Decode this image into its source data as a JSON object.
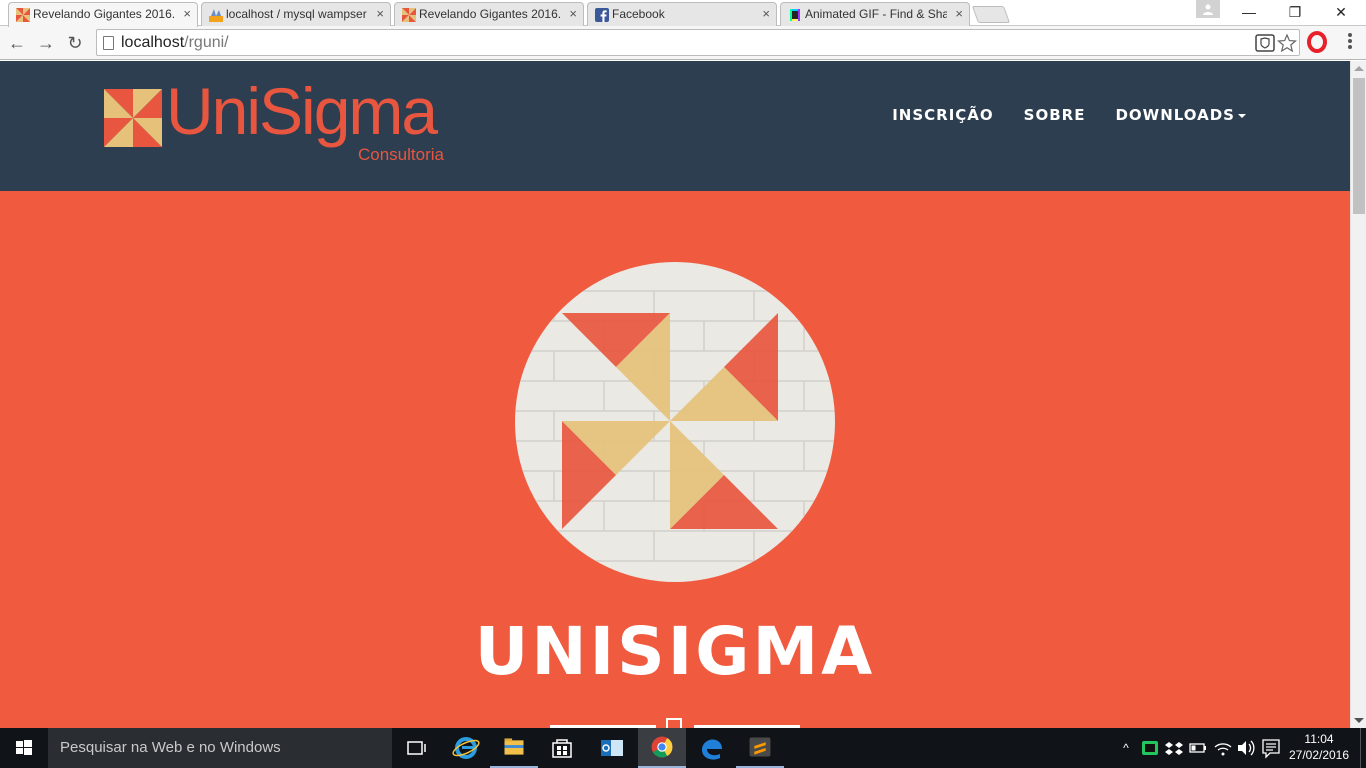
{
  "browser": {
    "tabs": [
      {
        "title": "Revelando Gigantes 2016.",
        "icon": "unisigma-favicon",
        "active": true
      },
      {
        "title": "localhost / mysql wampser",
        "icon": "phpmyadmin-favicon",
        "active": false
      },
      {
        "title": "Revelando Gigantes 2016.",
        "icon": "unisigma-favicon",
        "active": false
      },
      {
        "title": "Facebook",
        "icon": "facebook-favicon",
        "active": false
      },
      {
        "title": "Animated GIF - Find & Sha",
        "icon": "giphy-favicon",
        "active": false
      }
    ],
    "close_glyph": "×",
    "window_controls": {
      "minimize": "—",
      "restore": "❐",
      "close": "✕"
    },
    "address": {
      "host": "localhost",
      "path": "/rguni/"
    },
    "nav_glyphs": {
      "back": "←",
      "forward": "→",
      "reload": "↻"
    }
  },
  "site": {
    "brand": {
      "name": "UniSigma",
      "subtitle": "Consultoria"
    },
    "nav": [
      {
        "label": "INSCRIÇÃO"
      },
      {
        "label": "SOBRE"
      },
      {
        "label": "DOWNLOADS",
        "has_dropdown": true
      }
    ],
    "hero": {
      "title": "UNISIGMA"
    }
  },
  "colors": {
    "nav_background": "#2c3e50",
    "hero_background": "#f05b40",
    "brand_orange": "#e8563f",
    "brand_sand": "#e5c17a"
  },
  "taskbar": {
    "search_placeholder": "Pesquisar na Web e no Windows",
    "apps": [
      "task-view-icon",
      "edge-icon",
      "file-explorer-icon",
      "store-icon",
      "outlook-icon",
      "chrome-icon",
      "edge-icon",
      "sublime-text-icon"
    ],
    "tray": {
      "time": "11:04",
      "date": "27/02/2016"
    }
  }
}
